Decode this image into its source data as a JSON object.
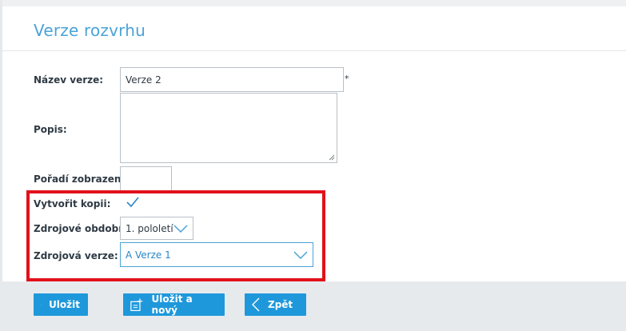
{
  "page": {
    "title": "Verze rozvrhu"
  },
  "form": {
    "name": {
      "label": "Název verze:",
      "value": "Verze 2",
      "required_mark": "*"
    },
    "description": {
      "label": "Popis:",
      "value": ""
    },
    "order": {
      "label": "Pořadí zobrazení:",
      "value": ""
    },
    "create_copy": {
      "label": "Vytvořit kopii:",
      "checked": true
    },
    "source_period": {
      "label": "Zdrojové období:",
      "selected": "1. pololetí"
    },
    "source_version": {
      "label": "Zdrojová verze:",
      "selected": "A Verze 1"
    }
  },
  "buttons": {
    "save": "Uložit",
    "save_new": "Uložit a nový",
    "back": "Zpět"
  },
  "colors": {
    "accent": "#1f98db",
    "title": "#4aa3d8",
    "highlight": "#e1111b"
  },
  "icons": {
    "save": "check-icon",
    "save_new": "add-document-icon",
    "back": "chevron-left-icon"
  }
}
